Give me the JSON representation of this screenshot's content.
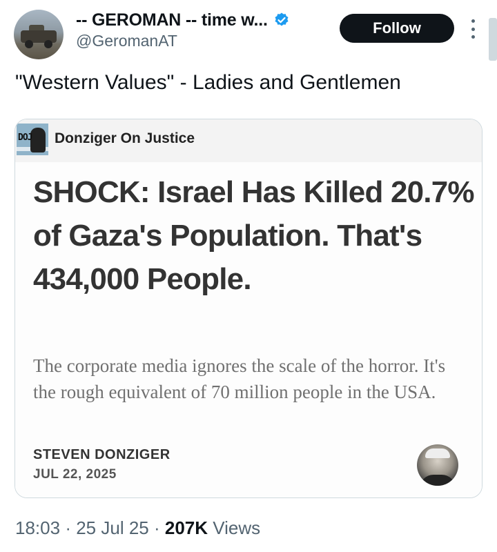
{
  "author": {
    "display_name": "-- GEROMAN -- time w...",
    "handle": "@GeromanAT",
    "verified_color": "#1d9bf0"
  },
  "follow_button": {
    "label": "Follow"
  },
  "tweet": {
    "text": "\"Western Values\" - Ladies and Gentlemen"
  },
  "card": {
    "publication": {
      "name": "Donziger On Justice",
      "logo_text": "DOJ"
    },
    "headline": "SHOCK: Israel Has Killed 20.7% of Gaza's Population. That's 434,000 People.",
    "subtitle": "The corporate media ignores the scale of the horror. It's the rough equivalent of 70 million people in the USA.",
    "author": "STEVEN DONZIGER",
    "date": "JUL 22, 2025"
  },
  "meta": {
    "time": "18:03",
    "separator": "·",
    "date": "25 Jul 25",
    "views_count": "207K",
    "views_label": "Views"
  },
  "icons": [
    "verified-badge-icon",
    "more-options-icon"
  ]
}
